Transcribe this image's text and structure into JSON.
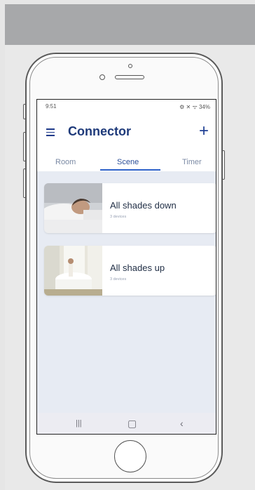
{
  "status_bar": {
    "time": "9:51",
    "indicators": "⚙ ✕ ᯤ 34%"
  },
  "header": {
    "menu_icon": "hamburger-icon",
    "title": "Connector",
    "add_icon": "plus-icon"
  },
  "tabs": [
    {
      "label": "Room",
      "active": false
    },
    {
      "label": "Scene",
      "active": true
    },
    {
      "label": "Timer",
      "active": false
    }
  ],
  "scenes": [
    {
      "title": "All shades down",
      "subtitle": "3 devices"
    },
    {
      "title": "All shades up",
      "subtitle": "3 devices"
    }
  ],
  "nav": {
    "recents_icon": "|||",
    "home_icon": "▢",
    "back_icon": "‹"
  },
  "colors": {
    "accent": "#2e62c9",
    "title": "#1e3a7a",
    "content_bg": "#e7ebf3"
  }
}
